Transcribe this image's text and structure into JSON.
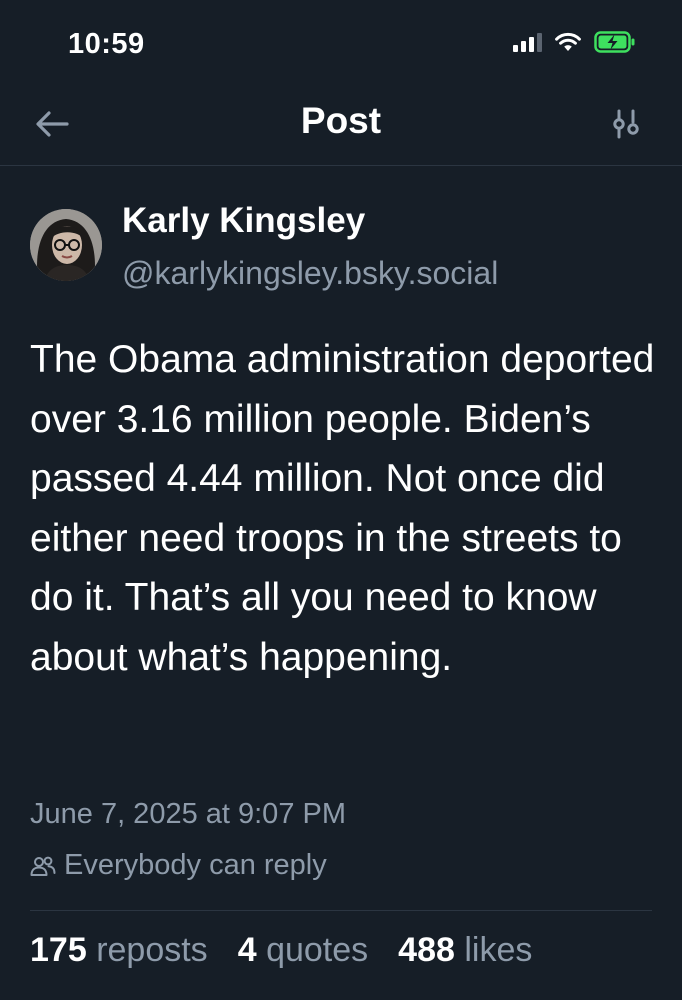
{
  "status_bar": {
    "time": "10:59",
    "icons": [
      "cellular-signal-icon",
      "wifi-icon",
      "battery-charging-icon"
    ],
    "battery_color": "#3ee05f"
  },
  "header": {
    "title": "Post",
    "back_icon": "arrow-left-icon",
    "settings_icon": "sliders-icon"
  },
  "post": {
    "author": {
      "name": "Karly Kingsley",
      "handle": "@karlykingsley.bsky.social"
    },
    "text": "The Obama administration deported over 3.16 million people. Biden’s passed 4.44 million. Not once did either need troops in the streets to do it. That’s all you need to know about what’s happening.",
    "date": "June 7, 2025 at 9:07 PM",
    "reply_setting": "Everybody can reply",
    "stats": {
      "reposts_count": "175",
      "reposts_label": "reposts",
      "quotes_count": "4",
      "quotes_label": "quotes",
      "likes_count": "488",
      "likes_label": "likes"
    }
  },
  "colors": {
    "background": "#161e27",
    "muted_text": "#8e9baa",
    "divider": "#2b3541"
  }
}
